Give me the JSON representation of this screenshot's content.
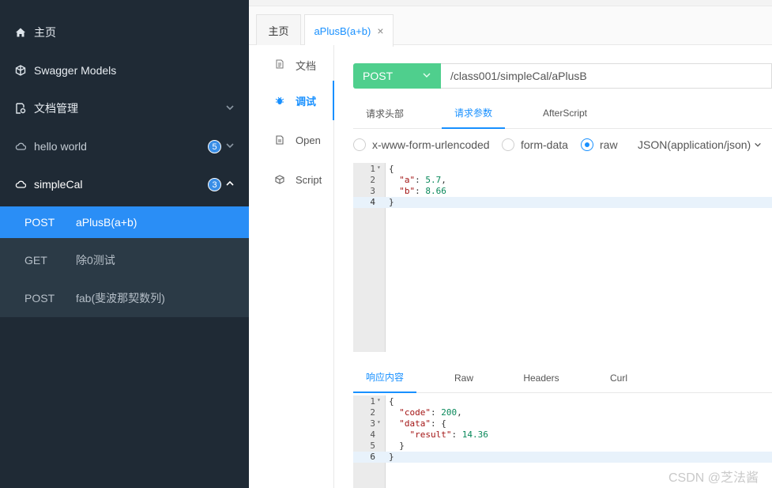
{
  "sidebar": {
    "items": [
      {
        "label": "主页",
        "icon": "home-icon"
      },
      {
        "label": "Swagger Models",
        "icon": "cube-icon"
      },
      {
        "label": "文档管理",
        "icon": "document-settings-icon"
      },
      {
        "label": "hello world",
        "icon": "cloud-icon",
        "badge": "5"
      },
      {
        "label": "simpleCal",
        "icon": "cloud-icon",
        "badge": "3"
      }
    ],
    "apis": [
      {
        "method": "POST",
        "name": "aPlusB(a+b)"
      },
      {
        "method": "GET",
        "name": "除0测试"
      },
      {
        "method": "POST",
        "name": "fab(斐波那契数列)"
      }
    ]
  },
  "tabs": {
    "home": "主页",
    "current": "aPlusB(a+b)",
    "close": "×"
  },
  "vmenu": {
    "items": [
      "文档",
      "调试",
      "Open",
      "Script"
    ]
  },
  "request": {
    "method": "POST",
    "url": "/class001/simpleCal/aPlusB"
  },
  "req_tabs": [
    "请求头部",
    "请求参数",
    "AfterScript"
  ],
  "body_types": {
    "opt1": "x-www-form-urlencoded",
    "opt2": "form-data",
    "opt3": "raw",
    "content_type": "JSON(application/json)"
  },
  "request_body": {
    "ln1": "1",
    "ln2": "2",
    "ln3": "3",
    "ln4": "4",
    "c1": "{",
    "key_a": "\"a\"",
    "val_a": "5.7",
    "key_b": "\"b\"",
    "val_b": "8.66",
    "c4": "}"
  },
  "resp_tabs": [
    "响应内容",
    "Raw",
    "Headers",
    "Curl"
  ],
  "response_body": {
    "ln1": "1",
    "ln2": "2",
    "ln3": "3",
    "ln4": "4",
    "ln5": "5",
    "ln6": "6",
    "c1": "{",
    "key_code": "\"code\"",
    "val_code": "200",
    "key_data": "\"data\"",
    "key_result": "\"result\"",
    "val_result": "14.36",
    "c5": "}",
    "c6": "}"
  },
  "watermark": "CSDN @芝法酱",
  "colors": {
    "sidebar_bg": "#1f2a35",
    "active_api": "#2a8ef6",
    "post_method": "#4fcf8d",
    "accent": "#1890ff"
  }
}
